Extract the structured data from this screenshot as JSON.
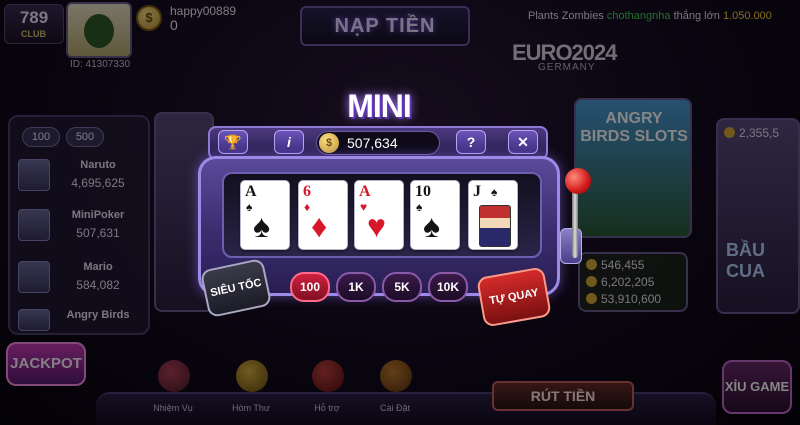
{
  "top": {
    "logo": "789",
    "logo_sub": "CLUB",
    "user_id": "ID: 41307330",
    "coin_glyph": "$",
    "username": "happy00889",
    "balance": "0",
    "deposit_label": "NẠP TIỀN",
    "ticker": {
      "game": "Plants Zombies",
      "player": "chothangnha",
      "won": "thắng lớn",
      "amount": "1.050.000"
    },
    "euro_title": "EURO2024",
    "euro_sub": "GERMANY"
  },
  "left_panel": {
    "chips": [
      "100",
      "500"
    ],
    "games": [
      {
        "name": "Naruto",
        "value": "4,695,625"
      },
      {
        "name": "MiniPoker",
        "value": "507,631"
      },
      {
        "name": "Mario",
        "value": "584,082"
      },
      {
        "name": "Angry Birds",
        "value": ""
      }
    ],
    "jackpot_label": "JACKPOT"
  },
  "background_cards": {
    "angry_birds_title": "ANGRY BIRDS SLOTS",
    "angry_birds_stats": [
      "546,455",
      "6,202,205",
      "53,910,600"
    ],
    "right_top_value": "2,355,5",
    "bau_cua": "BẦU CUA"
  },
  "mini_poker": {
    "title": "MINI POKER",
    "pot_coin": "$",
    "pot_value": "507,634",
    "buttons": {
      "trophy": "🏆",
      "info": "i",
      "help": "?",
      "close": "✕"
    },
    "cards": [
      {
        "rank": "A",
        "suit": "♠",
        "color": "black"
      },
      {
        "rank": "6",
        "suit": "♦",
        "color": "red"
      },
      {
        "rank": "A",
        "suit": "♥",
        "color": "red"
      },
      {
        "rank": "10",
        "suit": "♠",
        "color": "black"
      },
      {
        "rank": "J",
        "suit": "♠",
        "color": "black"
      }
    ],
    "turbo_label": "SIÊU TỐC",
    "bets": [
      "100",
      "1K",
      "5K",
      "10K"
    ],
    "active_bet": "100",
    "auto_label": "TỰ QUAY"
  },
  "bottom_nav": {
    "items": [
      "Nhiệm Vụ",
      "Hòm Thư",
      "Hỗ trợ",
      "Cài Đặt"
    ],
    "withdraw_label": "RÚT TIỀN",
    "xiu_label": "XỈU GAME"
  }
}
